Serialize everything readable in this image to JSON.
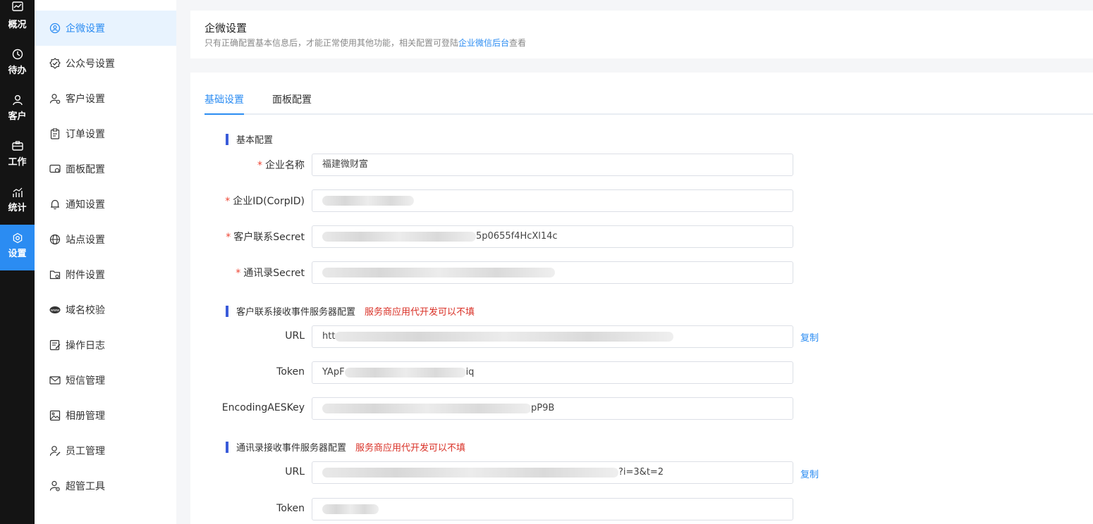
{
  "rail": [
    {
      "label": "概况",
      "icon": "overview-icon"
    },
    {
      "label": "待办",
      "icon": "todo-icon"
    },
    {
      "label": "客户",
      "icon": "customer-icon"
    },
    {
      "label": "工作",
      "icon": "work-icon"
    },
    {
      "label": "统计",
      "icon": "stats-icon"
    },
    {
      "label": "设置",
      "icon": "settings-icon",
      "active": true
    }
  ],
  "menu": [
    {
      "label": "企微设置",
      "icon": "wecom-icon",
      "active": true
    },
    {
      "label": "公众号设置",
      "icon": "verified-icon"
    },
    {
      "label": "客户设置",
      "icon": "customer-settings-icon"
    },
    {
      "label": "订单设置",
      "icon": "clipboard-icon"
    },
    {
      "label": "面板配置",
      "icon": "panel-icon"
    },
    {
      "label": "通知设置",
      "icon": "bell-icon"
    },
    {
      "label": "站点设置",
      "icon": "globe-icon"
    },
    {
      "label": "附件设置",
      "icon": "folder-icon"
    },
    {
      "label": "域名校验",
      "icon": "www-icon"
    },
    {
      "label": "操作日志",
      "icon": "log-icon"
    },
    {
      "label": "短信管理",
      "icon": "mail-icon"
    },
    {
      "label": "相册管理",
      "icon": "image-icon"
    },
    {
      "label": "员工管理",
      "icon": "user-edit-icon"
    },
    {
      "label": "超管工具",
      "icon": "admin-tool-icon"
    }
  ],
  "header": {
    "title": "企微设置",
    "desc_before": "只有正确配置基本信息后，才能正常使用其他功能，相关配置可登陆",
    "desc_link": "企业微信后台",
    "desc_after": "查看"
  },
  "tabs": [
    "基础设置",
    "面板配置"
  ],
  "sections": {
    "basic": {
      "title": "基本配置"
    },
    "customer_event": {
      "title": "客户联系接收事件服务器配置",
      "warn": "服务商应用代开发可以不填"
    },
    "contacts_event": {
      "title": "通讯录接收事件服务器配置",
      "warn": "服务商应用代开发可以不填"
    }
  },
  "fields": {
    "corp_name": {
      "label": "企业名称",
      "value": "福建微财富"
    },
    "corp_id": {
      "label": "企业ID(CorpID)",
      "value": ""
    },
    "customer_secret": {
      "label": "客户联系Secret",
      "value": "5p0655f4HcXl14c"
    },
    "contacts_secret": {
      "label": "通讯录Secret",
      "value": ""
    },
    "cust_url": {
      "label": "URL",
      "value": "htt"
    },
    "cust_token": {
      "label": "Token",
      "value_head": "YApF",
      "value_tail": "iq"
    },
    "cust_aes": {
      "label": "EncodingAESKey",
      "value": "pP9B"
    },
    "cont_url": {
      "label": "URL",
      "value": "?i=3&t=2"
    },
    "cont_token": {
      "label": "Token",
      "value": ""
    }
  },
  "copy_label": "复制",
  "colors": {
    "accent": "#2b8cf2",
    "rail_bg": "#141414",
    "warn": "#d93026",
    "section_bar": "#3a5bd9"
  }
}
